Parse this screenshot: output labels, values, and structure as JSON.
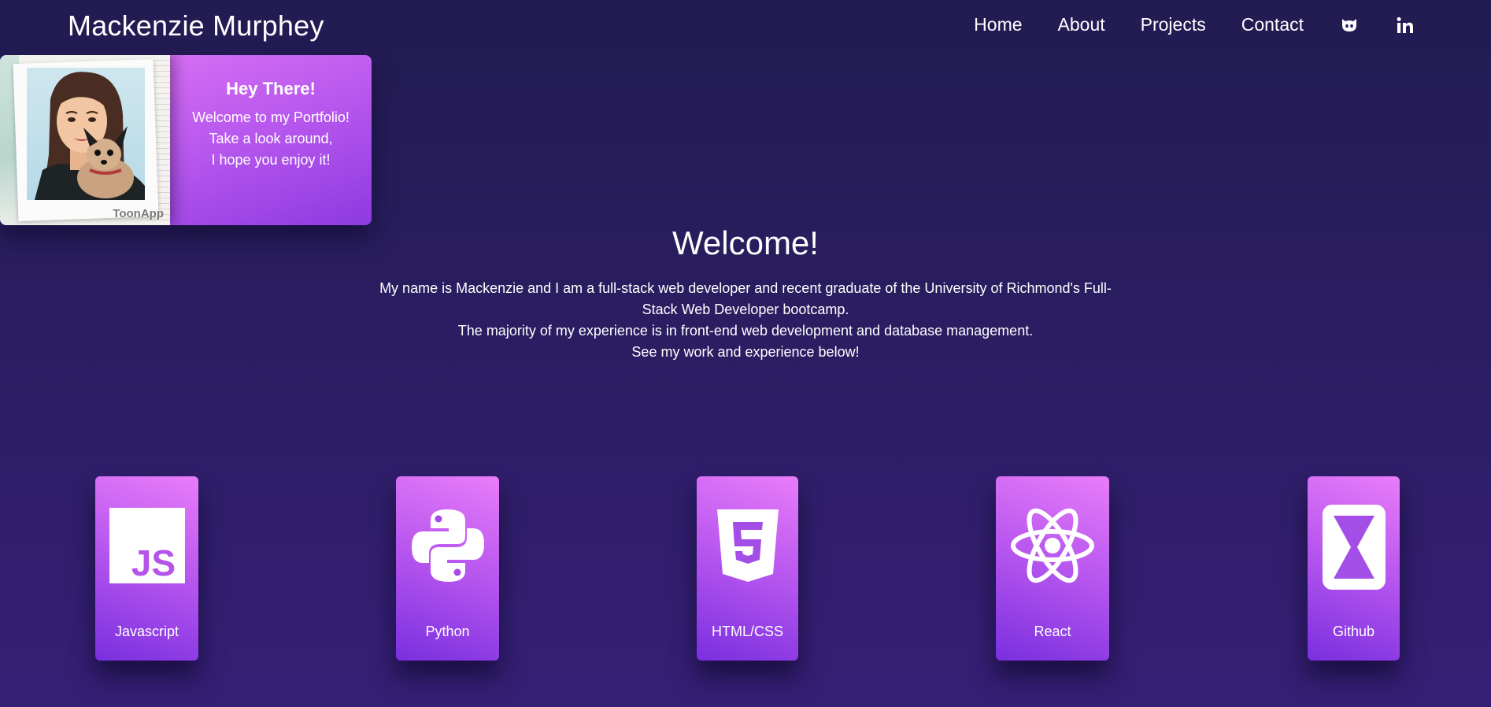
{
  "header": {
    "site_title": "Mackenzie Murphey",
    "nav": [
      "Home",
      "About",
      "Projects",
      "Contact"
    ],
    "icons": [
      "github-icon",
      "linkedin-icon"
    ]
  },
  "intro_card": {
    "heading": "Hey There!",
    "lines": [
      "Welcome to my Portfolio!",
      "Take a look around,",
      "I hope you enjoy it!"
    ],
    "photo_watermark": "ToonApp"
  },
  "welcome": {
    "title": "Welcome!",
    "lines": [
      "My name is Mackenzie and I am a full-stack web developer and recent graduate of the University of Richmond's Full-Stack Web Developer bootcamp.",
      "The majority of my experience is in front-end web development and database management.",
      "See my work and experience below!"
    ]
  },
  "skills": [
    {
      "label": "Javascript",
      "icon": "javascript-icon"
    },
    {
      "label": "Python",
      "icon": "python-icon"
    },
    {
      "label": "HTML/CSS",
      "icon": "html5-icon"
    },
    {
      "label": "React",
      "icon": "react-icon"
    },
    {
      "label": "Github",
      "icon": "glitch-icon"
    }
  ],
  "colors": {
    "background_top": "#221c52",
    "background_bottom": "#351f75",
    "card_gradient_light": "#e97cf9",
    "card_gradient_dark": "#7a2fdf"
  }
}
